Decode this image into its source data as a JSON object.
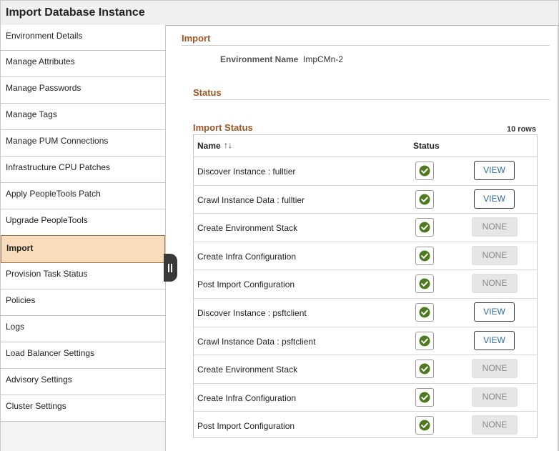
{
  "title": "Import Database Instance",
  "sidebar": {
    "items": [
      {
        "label": "Environment Details"
      },
      {
        "label": "Manage Attributes"
      },
      {
        "label": "Manage Passwords"
      },
      {
        "label": "Manage Tags"
      },
      {
        "label": "Manage PUM Connections"
      },
      {
        "label": "Infrastructure CPU Patches"
      },
      {
        "label": "Apply PeopleTools Patch"
      },
      {
        "label": "Upgrade PeopleTools"
      },
      {
        "label": "Import",
        "active": true
      },
      {
        "label": "Provision Task Status"
      },
      {
        "label": "Policies"
      },
      {
        "label": "Logs"
      },
      {
        "label": "Load Balancer Settings"
      },
      {
        "label": "Advisory Settings"
      },
      {
        "label": "Cluster Settings"
      }
    ]
  },
  "main": {
    "import_heading": "Import",
    "environment_name_label": "Environment Name",
    "environment_name_value": "ImpCMn-2",
    "status_heading": "Status",
    "grid_title": "Import Status",
    "row_count": "10 rows",
    "columns": {
      "name": "Name",
      "sort_icon": "↑↓",
      "status": "Status"
    },
    "rows": [
      {
        "name": "Discover Instance : fulltier",
        "status": "complete",
        "action": "VIEW"
      },
      {
        "name": "Crawl Instance Data : fulltier",
        "status": "complete",
        "action": "VIEW"
      },
      {
        "name": "Create Environment Stack",
        "status": "complete",
        "action": "NONE"
      },
      {
        "name": "Create Infra Configuration",
        "status": "complete",
        "action": "NONE"
      },
      {
        "name": "Post Import Configuration",
        "status": "complete",
        "action": "NONE"
      },
      {
        "name": "Discover Instance : psftclient",
        "status": "complete",
        "action": "VIEW"
      },
      {
        "name": "Crawl Instance Data : psftclient",
        "status": "complete",
        "action": "VIEW"
      },
      {
        "name": "Create Environment Stack",
        "status": "complete",
        "action": "NONE"
      },
      {
        "name": "Create Infra Configuration",
        "status": "complete",
        "action": "NONE"
      },
      {
        "name": "Post Import Configuration",
        "status": "complete",
        "action": "NONE"
      }
    ]
  },
  "colors": {
    "section_heading": "#9b5626",
    "active_item_bg": "#f8dcbb",
    "success_green": "#4e7a1e",
    "view_link": "#2a6ba3"
  },
  "icons": {
    "status_complete": "check-circle-icon",
    "collapse": "pane-collapse-icon",
    "sort": "sort-icon"
  }
}
